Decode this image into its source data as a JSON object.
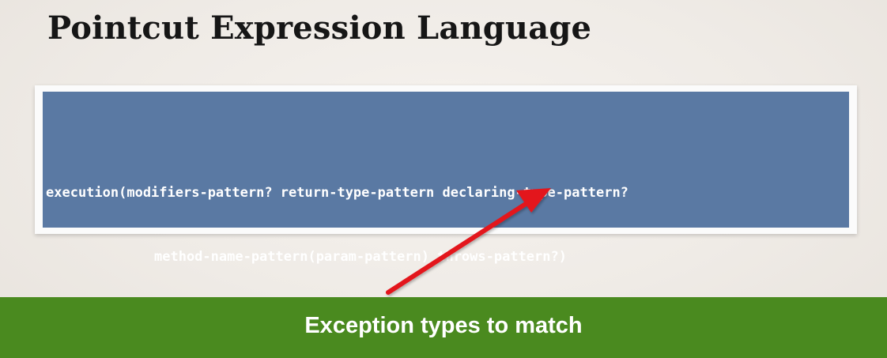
{
  "slide": {
    "title": "Pointcut Expression Language",
    "code": {
      "line1": "execution(modifiers-pattern? return-type-pattern declaring-type-pattern?",
      "line2": "method-name-pattern(param-pattern) throws-pattern?)"
    },
    "callout": "Exception types to match"
  },
  "colors": {
    "background": "#f1ede8",
    "code_box": "#5a79a3",
    "banner": "#4a8a1f",
    "arrow": "#e3141b"
  },
  "icons": {
    "arrow": "arrow-up-right-icon"
  }
}
